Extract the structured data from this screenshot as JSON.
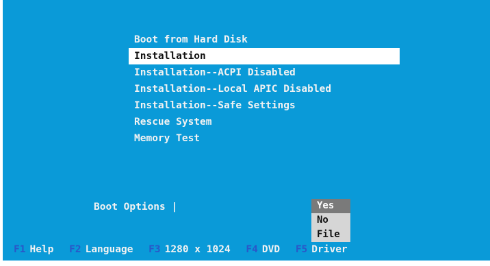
{
  "menu": {
    "items": [
      {
        "label": "Boot from Hard Disk"
      },
      {
        "label": "Installation"
      },
      {
        "label": "Installation--ACPI Disabled"
      },
      {
        "label": "Installation--Local APIC Disabled"
      },
      {
        "label": "Installation--Safe Settings"
      },
      {
        "label": "Rescue System"
      },
      {
        "label": "Memory Test"
      }
    ],
    "selected_index": 1
  },
  "boot_options": {
    "label": "Boot Options |"
  },
  "dropdown": {
    "options": [
      "Yes",
      "No",
      "File"
    ],
    "selected": "Yes"
  },
  "function_keys": [
    {
      "key": "F1",
      "label": "Help"
    },
    {
      "key": "F2",
      "label": "Language"
    },
    {
      "key": "F3",
      "label": "1280 x 1024"
    },
    {
      "key": "F4",
      "label": "DVD"
    },
    {
      "key": "F5",
      "label": "Driver"
    }
  ],
  "colors": {
    "background": "#0a9ad8",
    "text": "#f2f2f2",
    "highlight": "#ffffff",
    "fkey": "#2a57c8",
    "dropdown_bg": "#d6d6d6",
    "dropdown_selected": "#7a7a7a"
  }
}
